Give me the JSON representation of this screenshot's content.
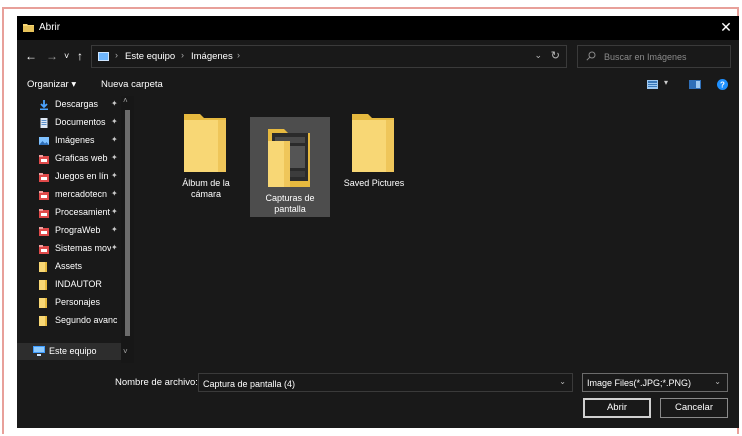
{
  "window": {
    "title": "Abrir",
    "close_glyph": "✕",
    "icon": "folder-app-icon"
  },
  "address": {
    "back_glyph": "←",
    "forward_glyph": "→",
    "recent_glyph": "˅",
    "up_glyph": "↑",
    "crumbs": [
      "Este equipo",
      "Imágenes"
    ],
    "separator": "›",
    "dropdown_glyph": "⌄",
    "refresh_glyph": "↻",
    "search_placeholder": "Buscar en Imágenes"
  },
  "toolbar": {
    "organize_label": "Organizar ▾",
    "new_folder_label": "Nueva carpeta"
  },
  "sidebar": {
    "items": [
      {
        "label": "Descargas",
        "icon": "download-icon",
        "pinned": true
      },
      {
        "label": "Documentos",
        "icon": "document-icon",
        "pinned": true
      },
      {
        "label": "Imágenes",
        "icon": "pictures-icon",
        "pinned": true
      },
      {
        "label": "Graficas web",
        "icon": "app-folder-icon",
        "pinned": true
      },
      {
        "label": "Juegos en lín",
        "icon": "app-folder-icon",
        "pinned": true
      },
      {
        "label": "mercadotecn",
        "icon": "app-folder-icon",
        "pinned": true
      },
      {
        "label": "Procesamient",
        "icon": "app-folder-icon",
        "pinned": true
      },
      {
        "label": "PrograWeb",
        "icon": "app-folder-icon",
        "pinned": true
      },
      {
        "label": "Sistemas mov",
        "icon": "app-folder-icon",
        "pinned": true
      },
      {
        "label": "Assets",
        "icon": "folder-icon",
        "pinned": false
      },
      {
        "label": "INDAUTOR",
        "icon": "folder-icon",
        "pinned": false
      },
      {
        "label": "Personajes",
        "icon": "folder-icon",
        "pinned": false
      },
      {
        "label": "Segundo avance",
        "icon": "folder-icon",
        "pinned": false
      },
      {
        "label": "Este equipo",
        "icon": "computer-icon",
        "pinned": false
      }
    ],
    "pin_glyph": "✦"
  },
  "folders": [
    {
      "name": "Álbum de la\ncámara",
      "selected": false,
      "has_preview": false
    },
    {
      "name": "Capturas de\npantalla",
      "selected": true,
      "has_preview": true
    },
    {
      "name": "Saved Pictures",
      "selected": false,
      "has_preview": false
    }
  ],
  "bottom": {
    "filename_label": "Nombre de archivo:",
    "filename_value": "Captura de pantalla (4)",
    "filetype_value": "Image Files(*.JPG;*.PNG)",
    "open_label": "Abrir",
    "cancel_label": "Cancelar"
  },
  "colors": {
    "background": "#191919",
    "titlebar": "#000000",
    "selection": "#4d4d4d",
    "folder_yellow": "#f8d775",
    "accent_blue": "#1e90ff",
    "frame_outline": "#e8a09a"
  }
}
